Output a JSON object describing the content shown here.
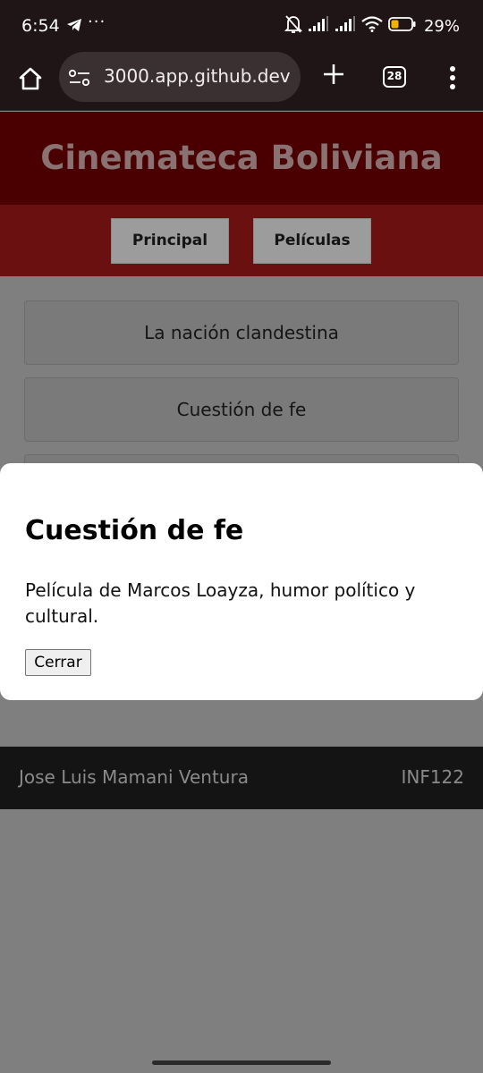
{
  "status_bar": {
    "time": "6:54",
    "battery_percent": "29%",
    "icons": [
      "telegram-icon",
      "more-notifications-icon",
      "bell-muted-icon",
      "signal-icon",
      "signal-icon",
      "wifi-icon",
      "battery-icon"
    ]
  },
  "browser": {
    "url": "3000.app.github.dev",
    "tab_count": "28",
    "icons": [
      "home-icon",
      "site-settings-icon",
      "plus-icon",
      "tabs-icon",
      "more-vert-icon"
    ]
  },
  "page": {
    "site_title": "Cinemateca Boliviana",
    "nav": [
      "Principal",
      "Películas"
    ],
    "movies": [
      "La nación clandestina",
      "Cuestión de fe",
      ""
    ],
    "footer": {
      "name": "Jose Luis Mamani Ventura",
      "code": "INF122"
    }
  },
  "modal": {
    "title": "Cuestión de fe",
    "description": "Película de Marcos Loayza, humor político y cultural.",
    "close_label": "Cerrar"
  },
  "colors": {
    "header_bg": "#4a0000",
    "nav_bg": "#6b1010",
    "overlay": "#7f7f7f",
    "footer_bg": "#141414",
    "browser_bg": "#1f1416"
  }
}
